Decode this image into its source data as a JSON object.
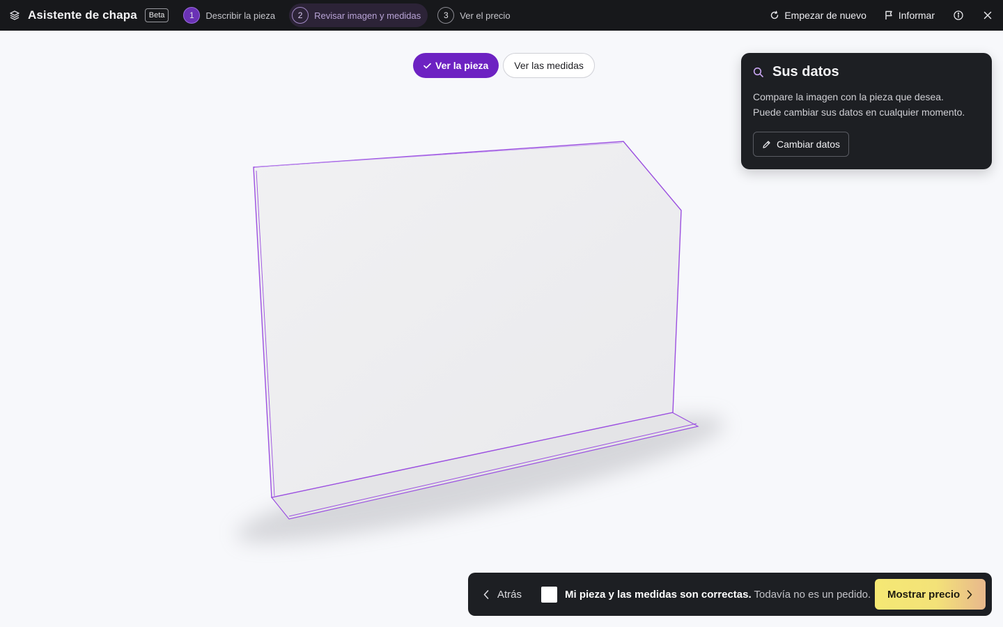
{
  "app": {
    "title": "Asistente de chapa",
    "badge": "Beta"
  },
  "steps": [
    {
      "num": "1",
      "label": "Describir la pieza"
    },
    {
      "num": "2",
      "label": "Revisar imagen y medidas"
    },
    {
      "num": "3",
      "label": "Ver el precio"
    }
  ],
  "toolbar": {
    "restart_label": "Empezar de nuevo",
    "report_label": "Informar"
  },
  "view_toggle": {
    "part_label": "Ver la pieza",
    "measures_label": "Ver las medidas"
  },
  "data_card": {
    "title": "Sus datos",
    "line1": "Compare la imagen con la pieza que desea.",
    "line2": "Puede cambiar sus datos en cualquier momento.",
    "button_label": "Cambiar datos"
  },
  "action_bar": {
    "back_label": "Atrás",
    "confirm_bold": "Mi pieza y las medidas son correctas.",
    "confirm_note": "Todavía no es un pedido.",
    "price_label": "Mostrar precio"
  },
  "colors": {
    "accent": "#6d22c2",
    "topbar": "#17181b",
    "outline": "#9b4fe0"
  }
}
